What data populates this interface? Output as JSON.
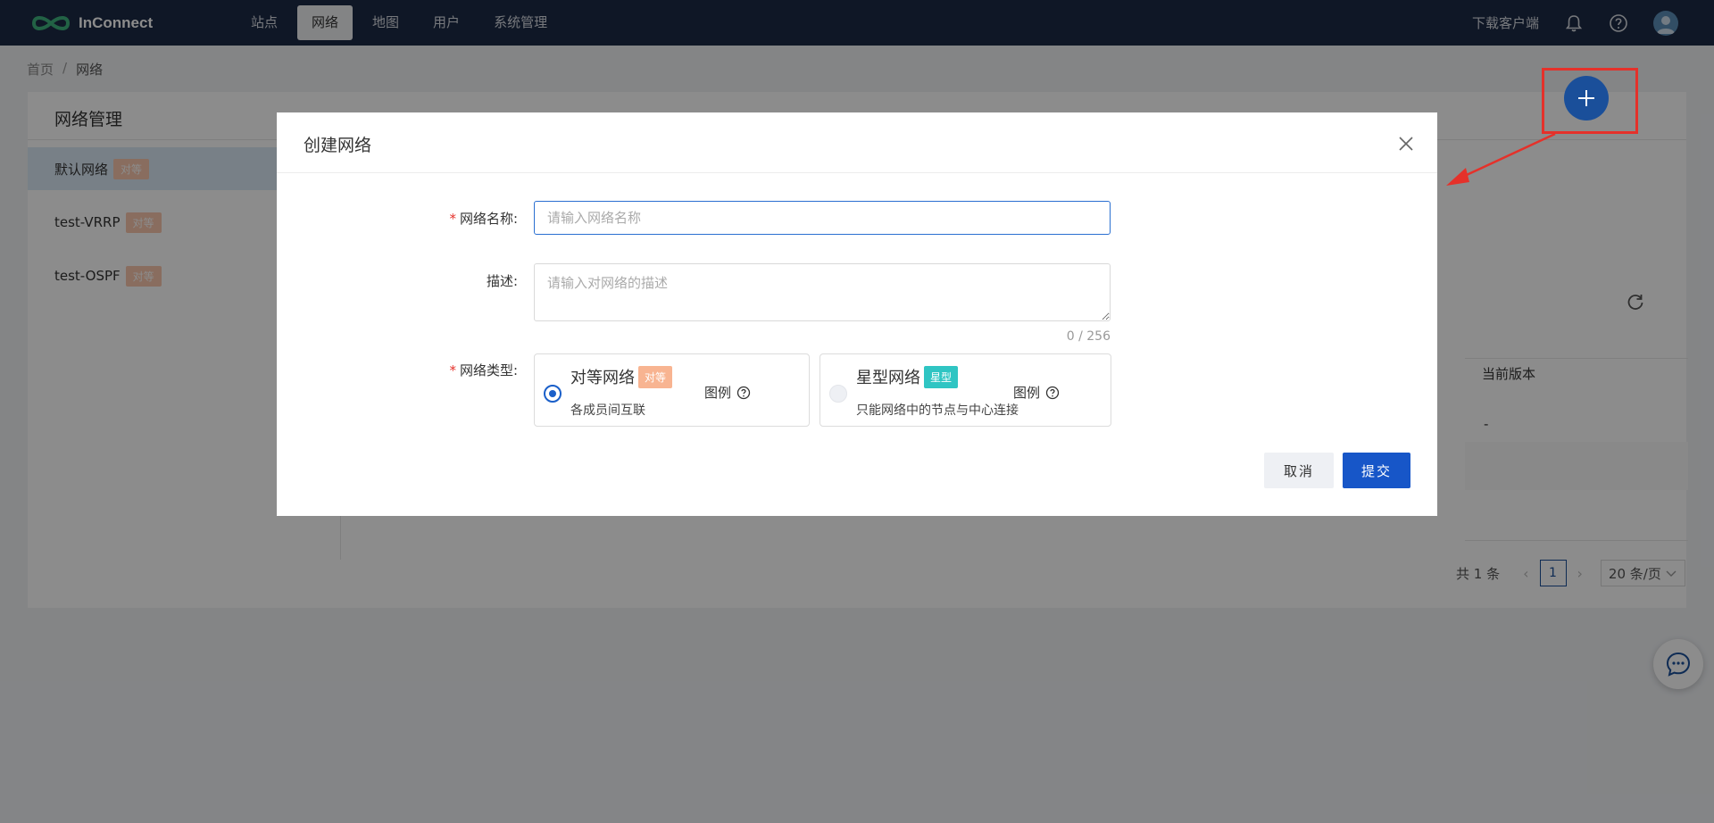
{
  "header": {
    "brand": "InConnect",
    "nav": [
      {
        "label": "站点"
      },
      {
        "label": "网络"
      },
      {
        "label": "地图"
      },
      {
        "label": "用户"
      },
      {
        "label": "系统管理"
      }
    ],
    "active_nav": "网络",
    "download_client": "下载客户端",
    "icons": [
      "bell-icon",
      "help-icon",
      "user-avatar"
    ]
  },
  "breadcrumb": {
    "home": "首页",
    "separator": "/",
    "current": "网络"
  },
  "network_panel": {
    "title": "网络管理",
    "networks": [
      {
        "name": "默认网络",
        "tag": "对等",
        "selected": true
      },
      {
        "name": "test-VRRP",
        "tag": "对等",
        "selected": false
      },
      {
        "name": "test-OSPF",
        "tag": "对等",
        "selected": false
      }
    ],
    "table": {
      "column_version": "当前版本",
      "row_version": "-"
    },
    "pagination": {
      "total": "共 1 条",
      "current_page": "1",
      "page_size": "20 条/页"
    }
  },
  "modal": {
    "title": "创建网络",
    "fields": {
      "name": {
        "label": "网络名称:",
        "required": true,
        "placeholder": "请输入网络名称",
        "value": ""
      },
      "description": {
        "label": "描述:",
        "required": false,
        "placeholder": "请输入对网络的描述",
        "value": "",
        "counter": "0 / 256"
      },
      "type": {
        "label": "网络类型:",
        "required": true,
        "options": [
          {
            "name": "对等网络",
            "tag": "对等",
            "desc": "各成员间互联",
            "legend": "图例",
            "selected": true
          },
          {
            "name": "星型网络",
            "tag": "星型",
            "desc": "只能网络中的节点与中心连接",
            "legend": "图例",
            "selected": false
          }
        ]
      }
    },
    "buttons": {
      "cancel": "取消",
      "submit": "提交"
    }
  },
  "colors": {
    "topbar": "#1d2b45",
    "primary": "#1756c8",
    "peer_tag": "#f8b491",
    "star_tag": "#2fc5c3",
    "annotation": "#e5312a"
  }
}
